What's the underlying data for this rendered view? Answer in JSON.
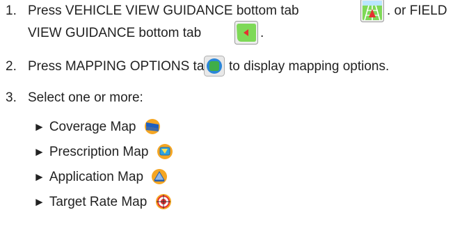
{
  "steps": [
    {
      "number": "1.",
      "line1_text": "Press VEHICLE VIEW GUIDANCE bottom tab",
      "line1_tail": ". or FIELD",
      "line2_text": "VIEW GUIDANCE bottom tab",
      "line2_tail": ".",
      "icons": [
        "vehicle-view-guidance-tab-icon",
        "field-view-guidance-tab-icon"
      ]
    },
    {
      "number": "2.",
      "text_before": "Press MAPPING OPTIONS tab",
      "text_after": "to display mapping options.",
      "icon": "mapping-options-tab-icon"
    },
    {
      "number": "3.",
      "text": "Select one or more:"
    }
  ],
  "options": [
    {
      "bullet": "►",
      "label": "Coverage Map",
      "icon": "coverage-map-icon"
    },
    {
      "bullet": "►",
      "label": "Prescription Map",
      "icon": "prescription-map-icon"
    },
    {
      "bullet": "►",
      "label": "Application Map",
      "icon": "application-map-icon"
    },
    {
      "bullet": "►",
      "label": "Target Rate Map",
      "icon": "target-rate-map-icon"
    }
  ],
  "colors": {
    "text": "#222222",
    "tab_green": "#7ed957",
    "tab_border": "#9a9a9a",
    "coverage_blue": "#1f5fbf",
    "orange": "#f5a623",
    "red": "#e53030"
  }
}
